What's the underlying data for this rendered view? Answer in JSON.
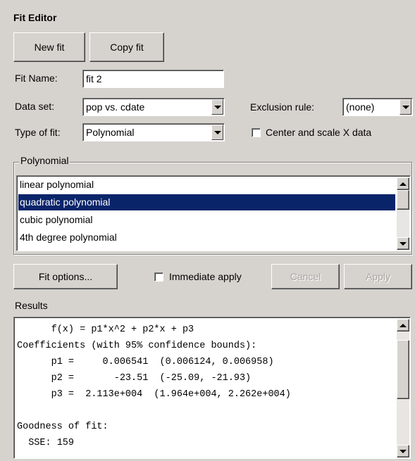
{
  "panel_title": "Fit Editor",
  "buttons": {
    "new_fit": "New fit",
    "copy_fit": "Copy fit",
    "fit_options": "Fit options...",
    "cancel": "Cancel",
    "apply": "Apply"
  },
  "fit_name": {
    "label": "Fit Name:",
    "value": "fit 2"
  },
  "data_set": {
    "label": "Data set:",
    "value": "pop vs. cdate"
  },
  "exclusion_rule": {
    "label": "Exclusion rule:",
    "value": "(none)"
  },
  "type_of_fit": {
    "label": "Type of fit:",
    "value": "Polynomial"
  },
  "center_scale": {
    "label": "Center and scale X data",
    "checked": false
  },
  "polynomial_group": {
    "title": "Polynomial",
    "items": [
      "linear polynomial",
      "quadratic polynomial",
      "cubic polynomial",
      "4th degree polynomial"
    ],
    "selected": "quadratic polynomial"
  },
  "immediate_apply": {
    "label": "Immediate apply",
    "checked": false
  },
  "results": {
    "label": "Results",
    "text": "      f(x) = p1*x^2 + p2*x + p3\nCoefficients (with 95% confidence bounds):\n      p1 =     0.006541  (0.006124, 0.006958)\n      p2 =       -23.51  (-25.09, -21.93)\n      p3 =  2.113e+004  (1.964e+004, 2.262e+004)\n\nGoodness of fit:\n  SSE: 159"
  },
  "colors": {
    "background": "#d6d3ce",
    "selection": "#0a246a"
  }
}
